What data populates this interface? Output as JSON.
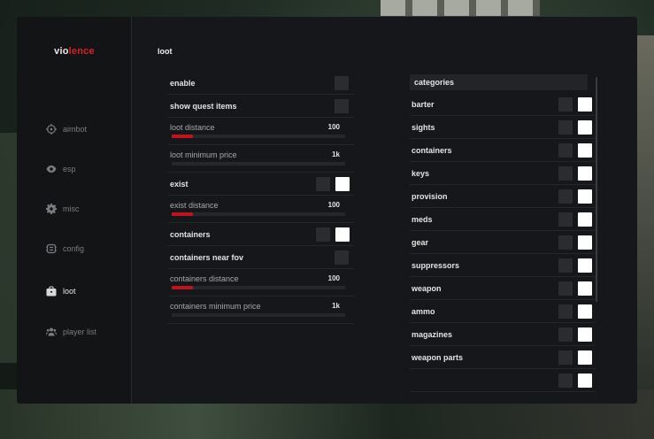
{
  "app": {
    "logo_part1": "vio",
    "logo_part2": "lence"
  },
  "sidebar": {
    "items": [
      {
        "label": "aimbot",
        "icon": "crosshair-icon"
      },
      {
        "label": "esp",
        "icon": "eye-icon"
      },
      {
        "label": "misc",
        "icon": "gear-icon"
      },
      {
        "label": "config",
        "icon": "config-icon"
      },
      {
        "label": "loot",
        "icon": "bag-icon",
        "active": true
      },
      {
        "label": "player list",
        "icon": "users-icon"
      }
    ]
  },
  "page": {
    "title": "loot"
  },
  "settings": {
    "enable": {
      "label": "enable"
    },
    "show_quest_items": {
      "label": "show quest items"
    },
    "loot_distance": {
      "label": "loot distance",
      "value": "100",
      "fraction": 0.12
    },
    "loot_min_price": {
      "label": "loot minimum price",
      "value": "1k",
      "fraction": 0.0
    },
    "exist": {
      "label": "exist"
    },
    "exist_distance": {
      "label": "exist distance",
      "value": "100",
      "fraction": 0.12
    },
    "containers": {
      "label": "containers"
    },
    "containers_near_fov": {
      "label": "containers near fov"
    },
    "containers_distance": {
      "label": "containers distance",
      "value": "100",
      "fraction": 0.12
    },
    "containers_min_price": {
      "label": "containers minimum price",
      "value": "1k",
      "fraction": 0.0
    }
  },
  "categories": {
    "header": "categories",
    "items": [
      {
        "label": "barter"
      },
      {
        "label": "sights"
      },
      {
        "label": "containers"
      },
      {
        "label": "keys"
      },
      {
        "label": "provision"
      },
      {
        "label": "meds"
      },
      {
        "label": "gear"
      },
      {
        "label": "suppressors"
      },
      {
        "label": "weapon"
      },
      {
        "label": "ammo"
      },
      {
        "label": "magazines"
      },
      {
        "label": "weapon parts"
      },
      {
        "label": ""
      }
    ]
  },
  "colors": {
    "accent": "#c0141d",
    "logo_accent": "#d8202a",
    "background": "#16171a"
  }
}
